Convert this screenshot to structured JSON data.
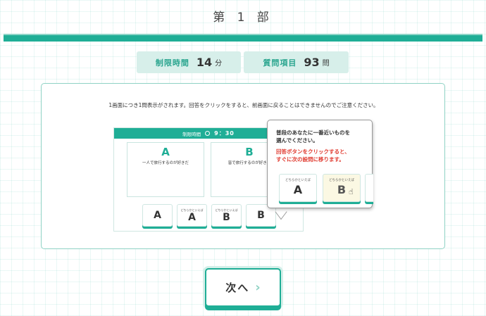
{
  "header": {
    "section_title": "第 1 部"
  },
  "info": {
    "time_label": "制限時間",
    "time_value": "14",
    "time_unit": "分",
    "questions_label": "質問項目",
    "questions_value": "93",
    "questions_unit": "問"
  },
  "instruction": "1画面につき1問表示がされます。回答をクリックをすると、前画面に戻ることはできませんのでご注意ください。",
  "illustration": {
    "header_label": "制限時間",
    "header_time": "9：30",
    "card_a": {
      "letter": "A",
      "text": "一人で旅行するのが好きだ"
    },
    "card_b": {
      "letter": "B",
      "text": "皆で旅行するのが好きだ"
    },
    "buttons": [
      {
        "small": "",
        "letter": "A"
      },
      {
        "small": "どちらかといえば",
        "letter": "A"
      },
      {
        "small": "どちらかといえば",
        "letter": "B"
      },
      {
        "small": "",
        "letter": "B"
      }
    ]
  },
  "callout": {
    "line1": "普段のあなたに一番近いものを",
    "line2": "選んでください。",
    "line3": "回答ボタンをクリックすると、",
    "line4": "すぐに次の設問に移ります。",
    "btn_a_small": "どちらかといえば",
    "btn_a_letter": "A",
    "btn_b_small": "どちらかといえば",
    "btn_b_letter": "B"
  },
  "next_button": {
    "label": "次へ"
  },
  "colors": {
    "accent": "#1fae96",
    "warning": "#e03a2f"
  }
}
